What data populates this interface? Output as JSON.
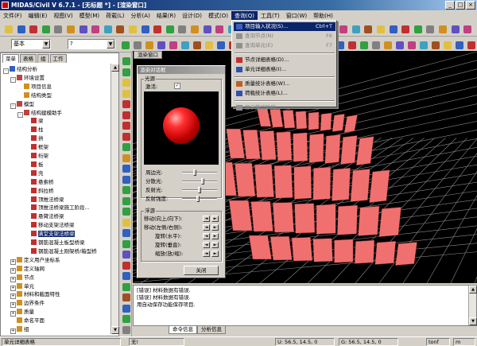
{
  "window": {
    "title": "MIDAS/Civil V 6.7.1 - [无标题 *] - [渲染窗口]",
    "min": "_",
    "max": "□",
    "close": "×"
  },
  "menu": [
    "文件(F)",
    "编辑(E)",
    "视图(V)",
    "模型(M)",
    "荷载(L)",
    "分析(A)",
    "结果(R)",
    "设计(D)",
    "模式(O)",
    "查询(Q)",
    "工具(T)",
    "窗口(W)",
    "帮助(H)"
  ],
  "menu_active_index": 9,
  "toolbar": {
    "unit_combo": "基本",
    "hint_combo": "?"
  },
  "left_tabs": [
    "菜单",
    "表格",
    "组",
    "工作"
  ],
  "tree": [
    {
      "label": "结构分析",
      "level": 0,
      "expander": "-",
      "icon": "#3060c0"
    },
    {
      "label": "环境设置",
      "level": 1,
      "expander": "-",
      "icon": "#c04040"
    },
    {
      "label": "项目信息",
      "level": 2,
      "icon": "#d09020"
    },
    {
      "label": "结构类型",
      "level": 2,
      "icon": "#d09020"
    },
    {
      "label": "模型",
      "level": 1,
      "expander": "-",
      "icon": "#c04040"
    },
    {
      "label": "结构建模助手",
      "level": 2,
      "expander": "-",
      "icon": "#c04040"
    },
    {
      "label": "梁",
      "level": 3,
      "icon": "#c03030"
    },
    {
      "label": "柱",
      "level": 3,
      "icon": "#c03030"
    },
    {
      "label": "拱",
      "level": 3,
      "icon": "#c03030"
    },
    {
      "label": "框架",
      "level": 3,
      "icon": "#c03030"
    },
    {
      "label": "桁架",
      "level": 3,
      "icon": "#c03030"
    },
    {
      "label": "板",
      "level": 3,
      "icon": "#c03030"
    },
    {
      "label": "壳",
      "level": 3,
      "icon": "#c03030"
    },
    {
      "label": "悬索桥",
      "level": 3,
      "icon": "#c03030"
    },
    {
      "label": "斜拉桥",
      "level": 3,
      "icon": "#c03030"
    },
    {
      "label": "顶推法桥梁",
      "level": 3,
      "icon": "#c03030"
    },
    {
      "label": "顶推法桥梁施工阶段...",
      "level": 3,
      "icon": "#c03030"
    },
    {
      "label": "悬臂法桥梁",
      "level": 3,
      "icon": "#c03030"
    },
    {
      "label": "移动支架法桥梁",
      "level": 3,
      "icon": "#c03030"
    },
    {
      "label": "满堂支架法桥梁",
      "level": 3,
      "icon": "#c03030",
      "selected": true
    },
    {
      "label": "钢筋混凝土板型桥梁",
      "level": 3,
      "icon": "#c03030"
    },
    {
      "label": "钢筋混凝土刚架桥/箱型桥",
      "level": 3,
      "icon": "#c03030"
    },
    {
      "label": "定义用户坐标系",
      "level": 1,
      "expander": "+",
      "icon": "#d09020"
    },
    {
      "label": "定义轴网",
      "level": 1,
      "expander": "+",
      "icon": "#d09020"
    },
    {
      "label": "节点",
      "level": 1,
      "expander": "+",
      "icon": "#d09020"
    },
    {
      "label": "单元",
      "level": 1,
      "expander": "+",
      "icon": "#d09020"
    },
    {
      "label": "材料和截面特性",
      "level": 1,
      "expander": "+",
      "icon": "#d09020"
    },
    {
      "label": "边界条件",
      "level": 1,
      "expander": "+",
      "icon": "#d09020"
    },
    {
      "label": "质量",
      "level": 1,
      "expander": "+",
      "icon": "#d09020"
    },
    {
      "label": "命名平面",
      "level": 1,
      "icon": "#d09020"
    },
    {
      "label": "组",
      "level": 1,
      "expander": "+",
      "icon": "#d09020"
    }
  ],
  "viewport": {
    "tab": "渲染窗口"
  },
  "render_dialog": {
    "title": "渲染对话框",
    "light_group": "光源",
    "enable_label": "激活:",
    "enable_mark": "✓",
    "sliders": [
      {
        "label": "周边光:",
        "value": 0.35
      },
      {
        "label": "分散光:",
        "value": 0.6
      },
      {
        "label": "反射光:",
        "value": 0.5
      },
      {
        "label": "反射强度:",
        "value": 0.45
      }
    ],
    "move_group": "浮游",
    "move_rows": [
      "移动(向上/向下):",
      "移动(左侧/右侧):",
      "旋转(水平):",
      "旋转(垂直):",
      "缩放(放/缩):"
    ],
    "close_btn": "关闭"
  },
  "query_menu": [
    {
      "label": "项目输入状况(S)...",
      "shortcut": "Ctrl+T",
      "state": "hl",
      "icon": "#4060c0"
    },
    {
      "label": "查询节点(N)",
      "shortcut": "F6",
      "state": "dis",
      "icon": "#909090"
    },
    {
      "label": "查询单元(E)",
      "shortcut": "F7",
      "state": "dis",
      "icon": "#909090"
    },
    {
      "sep": true
    },
    {
      "label": "节点详细表格(D)...",
      "shortcut": "",
      "state": "",
      "icon": "#c03030"
    },
    {
      "label": "单元详细表格(I)...",
      "shortcut": "",
      "state": "",
      "icon": "#3050b0"
    },
    {
      "sep": true
    },
    {
      "label": "质量统计表格(W)...",
      "shortcut": "",
      "state": "",
      "icon": "#c06020"
    },
    {
      "label": "荷载统计表格(L)...",
      "shortcut": "",
      "state": "",
      "icon": "#3050b0"
    },
    {
      "sep": true
    },
    {
      "label": "显示施工阶段...",
      "shortcut": "",
      "state": "dis",
      "icon": "#909090"
    }
  ],
  "output": {
    "lines": [
      "[错误] 材料数据有错误.",
      "[错误] 材料数据有错误.",
      "用自动保存功能保存项目."
    ]
  },
  "output_tabs": [
    "命令信息",
    "分析信息"
  ],
  "status": {
    "left": "单元详细表格",
    "p1": "无!",
    "p2": "U: 56.5, 14.5, 0",
    "p3": "G: 56.5, 14.5, 0",
    "unit1": "tonf",
    "unit2": "m"
  },
  "colors": {
    "accent": "#0a246a",
    "mesh": "#f07070",
    "sphere": "#e01010"
  }
}
